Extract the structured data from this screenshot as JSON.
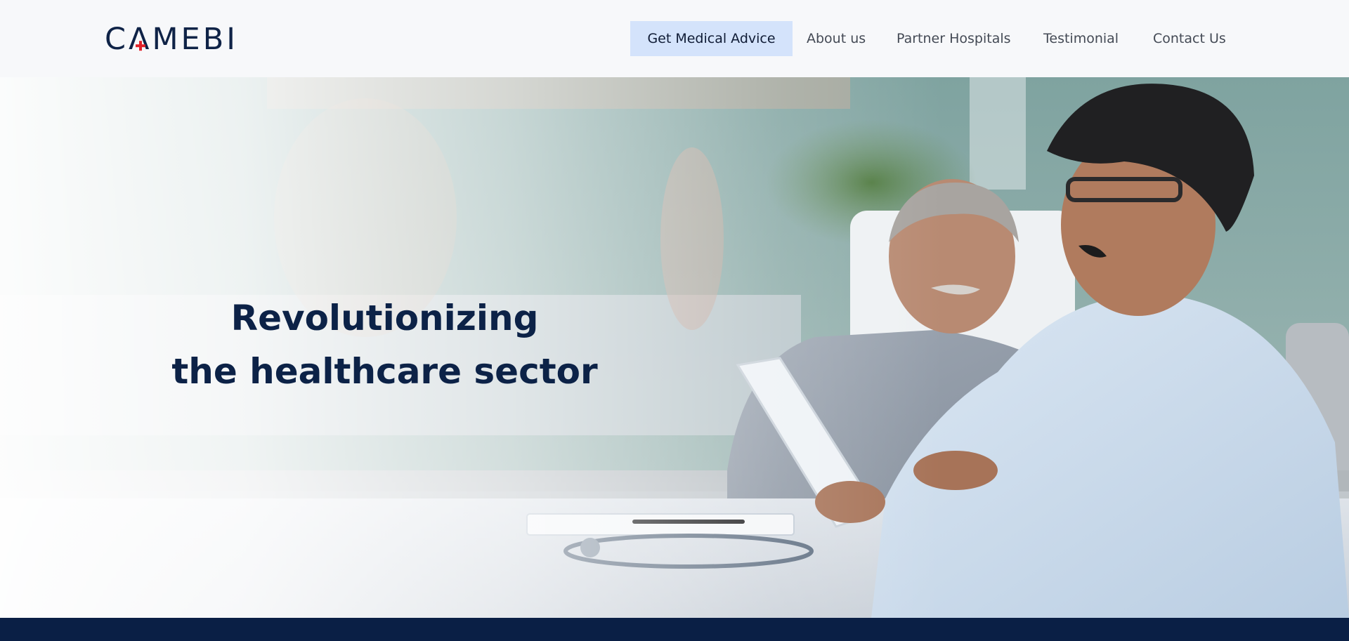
{
  "header": {
    "logo_text": "CAMEBI",
    "nav": {
      "primary": "Get Medical Advice",
      "about": "About us",
      "partners": "Partner Hospitals",
      "testimonial": "Testimonial",
      "contact": "Contact Us"
    }
  },
  "hero": {
    "title_line1": "Revolutionizing",
    "title_line2": "the healthcare sector"
  },
  "colors": {
    "brand_navy": "#0c2247",
    "brand_red": "#e2232a",
    "nav_highlight": "#d4e3fb",
    "footer_bar": "#0a1f45"
  }
}
